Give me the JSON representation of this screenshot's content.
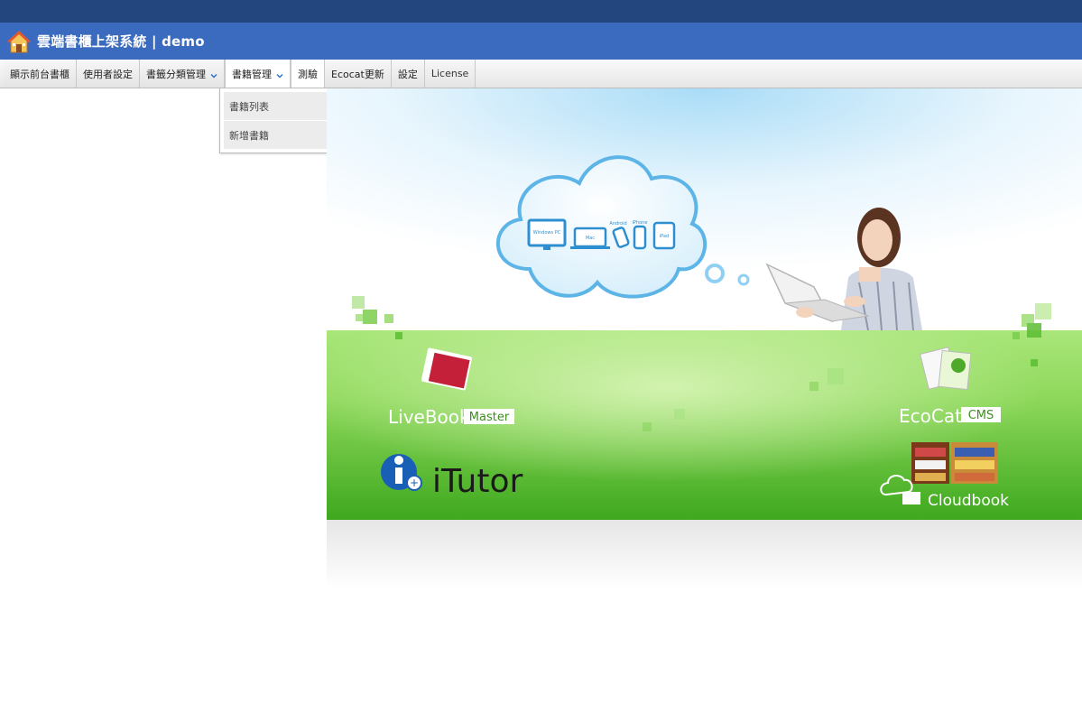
{
  "header": {
    "title": "雲端書櫃上架系統 | demo"
  },
  "menu": {
    "items": [
      {
        "label": "顯示前台書櫃"
      },
      {
        "label": "使用者設定"
      },
      {
        "label": "書籤分類管理"
      },
      {
        "label": "書籍管理"
      },
      {
        "label": "測驗"
      },
      {
        "label": "Ecocat更新"
      },
      {
        "label": "設定"
      },
      {
        "label": "License"
      }
    ]
  },
  "dropdown": {
    "items": [
      {
        "label": "書籍列表"
      },
      {
        "label": "新增書籍"
      }
    ]
  },
  "banner": {
    "cloud_devices": [
      "Windows PC",
      "Mac",
      "Android",
      "iPhone",
      "iPad"
    ],
    "products": {
      "livebook": "LiveBook",
      "livebook_badge": "Master",
      "ecocat": "EcoCat",
      "ecocat_badge": "CMS",
      "itutor": "iTutor",
      "cloudbook": "Cloudbook"
    }
  },
  "colors": {
    "topstrip": "#23467e",
    "header": "#3a6bbf",
    "banner_green": "#5fc23a"
  }
}
